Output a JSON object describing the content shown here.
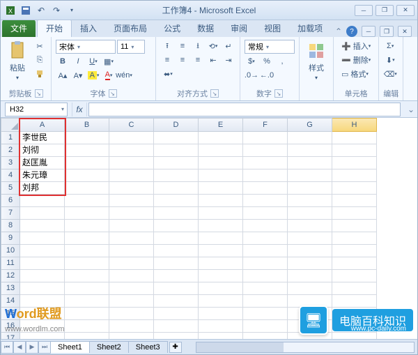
{
  "title": "工作簿4 - Microsoft Excel",
  "tabs": {
    "file": "文件",
    "list": [
      "开始",
      "插入",
      "页面布局",
      "公式",
      "数据",
      "审阅",
      "视图",
      "加载项"
    ],
    "active_index": 0
  },
  "ribbon": {
    "clipboard": {
      "paste": "粘贴",
      "label": "剪贴板"
    },
    "font": {
      "name": "宋体",
      "size": "11",
      "label": "字体"
    },
    "align": {
      "label": "对齐方式"
    },
    "number": {
      "format": "常规",
      "label": "数字"
    },
    "styles": {
      "btn": "样式",
      "label": ""
    },
    "cells": {
      "insert": "插入",
      "delete": "删除",
      "format": "格式",
      "label": "单元格"
    },
    "editing": {
      "label": "编辑"
    }
  },
  "namebox": "H32",
  "fx": "fx",
  "columns": [
    "A",
    "B",
    "C",
    "D",
    "E",
    "F",
    "G",
    "H"
  ],
  "selected_col": "H",
  "rows_count": 17,
  "cells": {
    "A1": "李世民",
    "A2": "刘彻",
    "A3": "赵匡胤",
    "A4": "朱元璋",
    "A5": "刘邦"
  },
  "sheets": [
    "Sheet1",
    "Sheet2",
    "Sheet3"
  ],
  "active_sheet": 0,
  "watermark_left": {
    "brand_w": "W",
    "brand_rest": "ord联盟",
    "url": "www.wordlm.com"
  },
  "watermark_right": {
    "text": "电脑百科知识",
    "url": "www.pc-daily.com"
  }
}
